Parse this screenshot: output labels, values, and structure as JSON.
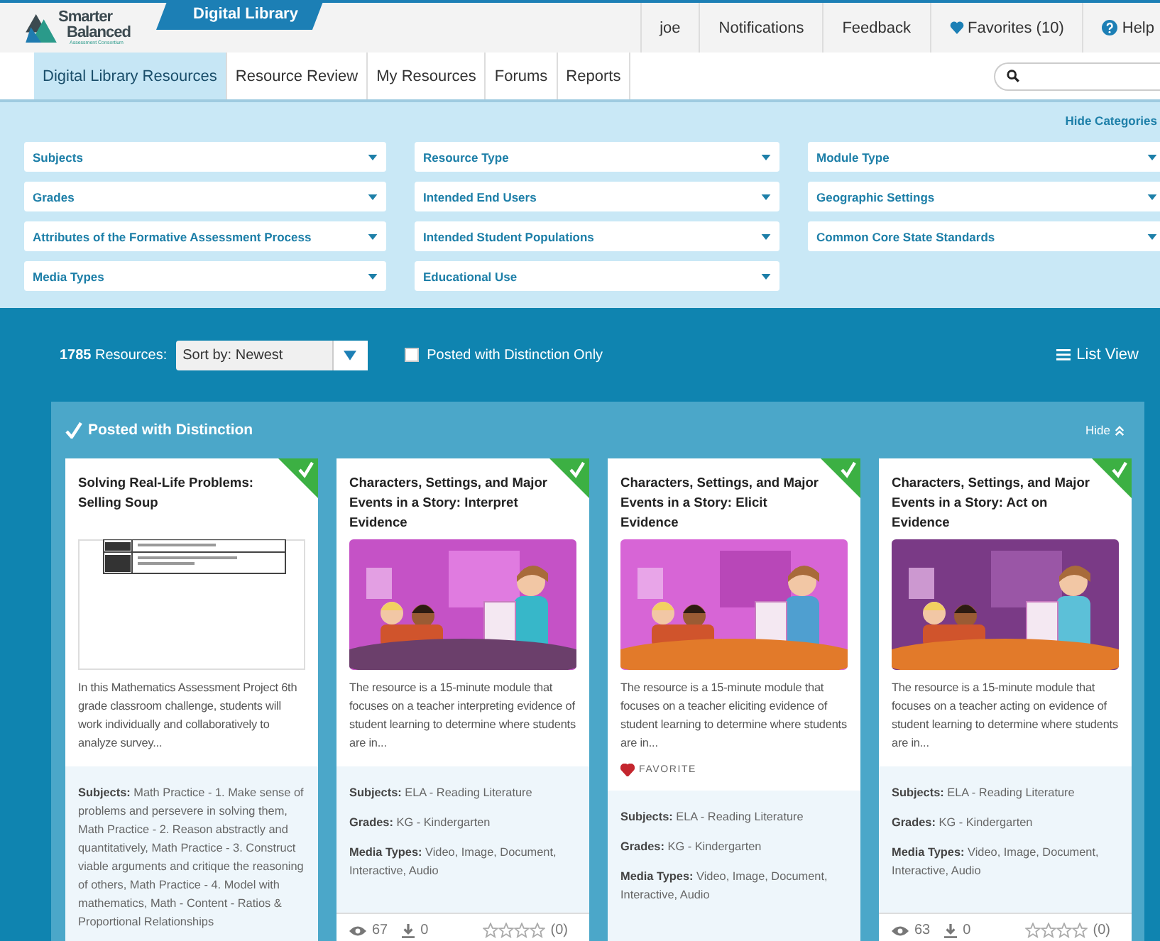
{
  "header": {
    "logo": {
      "line1": "Smarter",
      "line2": "Balanced",
      "tagline": "Assessment Consortium"
    },
    "product": "Digital Library",
    "menu": [
      {
        "label": "joe",
        "kind": "plain"
      },
      {
        "label": "Notifications",
        "kind": "plain"
      },
      {
        "label": "Feedback",
        "kind": "plain"
      },
      {
        "label": "Favorites (10)",
        "kind": "favorites"
      },
      {
        "label": "Help",
        "kind": "help"
      }
    ]
  },
  "nav": {
    "tabs": [
      {
        "label": "Digital Library Resources",
        "selected": true
      },
      {
        "label": "Resource Review",
        "selected": false
      },
      {
        "label": "My Resources",
        "selected": false
      },
      {
        "label": "Forums",
        "selected": false
      },
      {
        "label": "Reports",
        "selected": false
      }
    ]
  },
  "filters": {
    "toggle": "Hide Categories",
    "columns": [
      [
        "Subjects",
        "Grades",
        "Attributes of the Formative Assessment Process",
        "Media Types"
      ],
      [
        "Resource Type",
        "Intended End Users",
        "Intended Student Populations",
        "Educational Use"
      ],
      [
        "Module Type",
        "Geographic Settings",
        "Common Core State Standards"
      ]
    ]
  },
  "toolbar": {
    "count": "1785",
    "count_label": "Resources:",
    "sort": "Sort by: Newest",
    "distinction_only": {
      "label": "Posted with Distinction Only",
      "checked": false
    },
    "view": "List View"
  },
  "section": {
    "title": "Posted with Distinction",
    "hide": "Hide",
    "cards": [
      {
        "title": "Solving Real-Life Problems: Selling Soup",
        "distinction": true,
        "kind": "document",
        "description": "In this Mathematics Assessment Project 6th grade classroom challenge, students will work individually and collaboratively to analyze survey...",
        "meta": [
          "**Subjects:** Math Practice - 1. Make sense of problems and persevere in solving them, Math Practice - 2. Reason abstractly and quantitatively, Math Practice - 3. Construct viable arguments and critique the reasoning of others, Math Practice - 4. Model with mathematics, Math - Content - Ratios & Proportional Relationships"
        ]
      },
      {
        "title": "Characters, Settings, and Major Events in a Story: Interpret Evidence",
        "distinction": true,
        "kind": "picture",
        "description": "The resource is a 15-minute module that focuses on a teacher interpreting evidence of student learning to determine where students are in...",
        "meta": [
          "**Subjects:** ELA - Reading Literature",
          "**Grades:** KG - Kindergarten",
          "**Media Types:** Video, Image, Document, Interactive, Audio"
        ],
        "stats": {
          "views": "67",
          "downloads": "0",
          "stars": 0,
          "ratings": "(0)"
        }
      },
      {
        "title": "Characters, Settings, and Major Events in a Story: Elicit Evidence",
        "distinction": true,
        "kind": "picture",
        "description": "The resource is a 15-minute module that focuses on a teacher eliciting evidence of student learning to determine where students are in...",
        "favorite": {
          "label": "FAVORITE",
          "on": true
        },
        "meta": [
          "**Subjects:** ELA - Reading Literature",
          "**Grades:** KG - Kindergarten",
          "**Media Types:** Video, Image, Document, Interactive, Audio"
        ]
      },
      {
        "title": "Characters, Settings, and Major Events in a Story: Act on Evidence",
        "distinction": true,
        "kind": "picture",
        "description": "The resource is a 15-minute module that focuses on a teacher acting on evidence of student learning to determine where students are in...",
        "meta": [
          "**Subjects:** ELA - Reading Literature",
          "**Grades:** KG - Kindergarten",
          "**Media Types:** Video, Image, Document, Interactive, Audio"
        ],
        "stats": {
          "views": "63",
          "downloads": "0",
          "stars": 0,
          "ratings": "(0)"
        }
      }
    ]
  }
}
